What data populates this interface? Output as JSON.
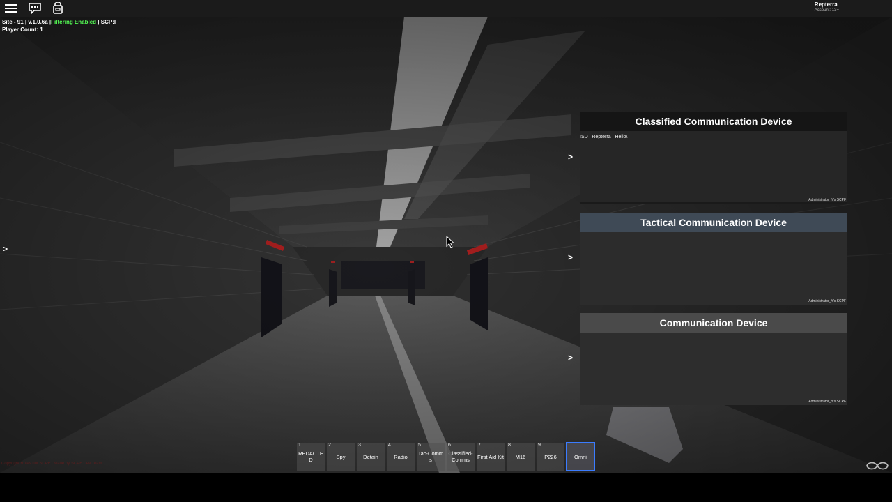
{
  "topbar": {
    "icons": [
      "hamburger-menu-icon",
      "chat-icon",
      "backpack-icon"
    ],
    "user": {
      "name": "Repterra",
      "account": "Account: 13+"
    }
  },
  "server": {
    "site": "Site - 91 | v.1.0.6a |",
    "filtering": "Filtering Enabled",
    "scp": "| SCP:F",
    "player_count": "Player Count: 1"
  },
  "copyright": "Copyright Rules not SCPF | Made by SCPF Dev Team",
  "panels": [
    {
      "title": "Classified Communication Device",
      "message": "ISD | Repterra : Hello\\",
      "credit": "Administrator_Y's SCPF"
    },
    {
      "title": "Tactical Communication Device",
      "message": "",
      "credit": "Administrator_Y's SCPF"
    },
    {
      "title": "Communication Device",
      "message": "",
      "credit": "Administrator_Y's SCPF"
    }
  ],
  "arrow_glyph": ">",
  "hotbar": [
    {
      "num": "1",
      "label": "REDACTED"
    },
    {
      "num": "2",
      "label": "Spy"
    },
    {
      "num": "3",
      "label": "Detain"
    },
    {
      "num": "4",
      "label": "Radio"
    },
    {
      "num": "5",
      "label": "Tac-Comms"
    },
    {
      "num": "6",
      "label": "Classified-Comms"
    },
    {
      "num": "7",
      "label": "First Aid Kit"
    },
    {
      "num": "8",
      "label": "M16"
    },
    {
      "num": "9",
      "label": "P226"
    },
    {
      "num": "",
      "label": "Omni",
      "selected": true
    }
  ],
  "colors": {
    "selected_outline": "#3b7cff",
    "filtering_green": "#55ff55"
  }
}
